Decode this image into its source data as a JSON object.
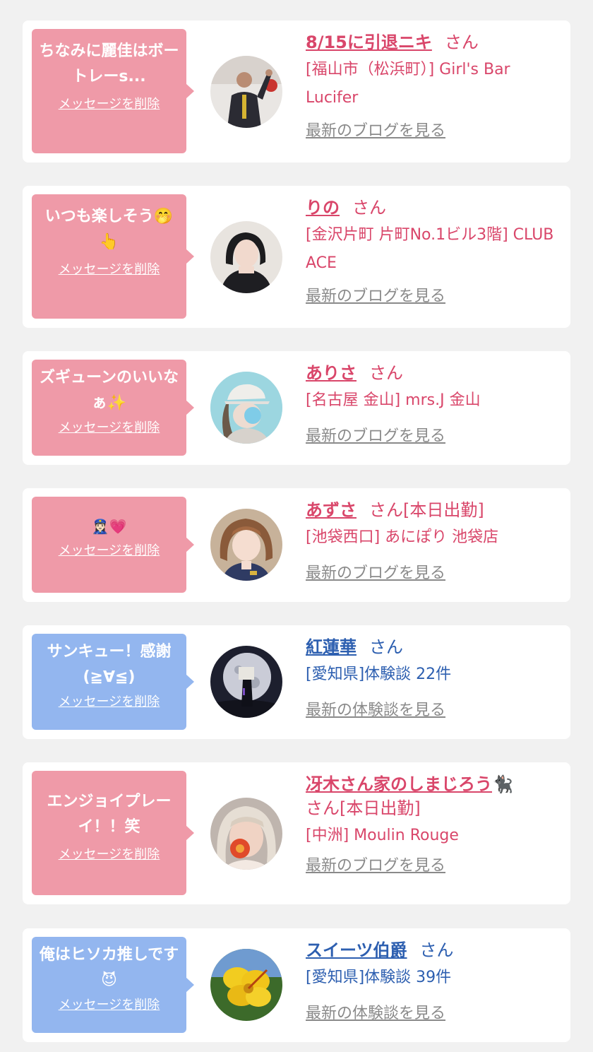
{
  "colors": {
    "pink_bubble": "#ef9aa8",
    "blue_bubble": "#93b6ef",
    "pink_text": "#d9466a",
    "blue_text": "#2d5fb0",
    "muted_link": "#8a8a8a",
    "background": "#f1f1f1"
  },
  "delete_label": "メッセージを削除",
  "cards": [
    {
      "theme": "pink",
      "message": "ちなみに麗佳はボートレーs...",
      "message_emoji": "",
      "name": "8/15に引退ニキ",
      "name_emoji": "",
      "suffix": "さん",
      "shop": "[福山市（松浜町）] Girl's Bar Lucifer",
      "link": "最新のブログを見る",
      "avatar_icon": "man-speaking-photo"
    },
    {
      "theme": "pink",
      "message": "いつも楽しそう",
      "message_emoji": "🤭👆",
      "name": "りの",
      "name_emoji": "",
      "suffix": "さん",
      "shop": "[金沢片町 片町No.1ビル3階] CLUB ACE",
      "link": "最新のブログを見る",
      "avatar_icon": "woman-portrait-photo"
    },
    {
      "theme": "pink",
      "message": "ズギューンのいいなぁ",
      "message_emoji": "✨",
      "name": "ありさ",
      "name_emoji": "",
      "suffix": "さん",
      "shop": "[名古屋 金山] mrs.J 金山",
      "link": "最新のブログを見る",
      "avatar_icon": "woman-cap-photo"
    },
    {
      "theme": "pink",
      "message": "",
      "message_emoji": "👮🏻‍♀️💗",
      "name": "あずさ",
      "name_emoji": "",
      "suffix": "さん[本日出勤]",
      "shop": "[池袋西口] あにぽり 池袋店",
      "link": "最新のブログを見る",
      "avatar_icon": "woman-police-photo"
    },
    {
      "theme": "blue",
      "message": "サンキュー！感謝(≧∀≦)",
      "message_emoji": "",
      "name": "紅蓮華",
      "name_emoji": "",
      "suffix": "さん",
      "shop": "[愛知県]体験談 22件",
      "link": "最新の体験談を見る",
      "avatar_icon": "moon-night-photo"
    },
    {
      "theme": "pink",
      "message": "エンジョイプレーイ！！笑",
      "message_emoji": "",
      "name": "冴木さん家のしまじろう",
      "name_emoji": "🐈‍⬛",
      "suffix": "さん[本日出勤]",
      "shop": "[中洲] Moulin Rouge",
      "link": "最新のブログを見る",
      "avatar_icon": "woman-flower-photo"
    },
    {
      "theme": "blue",
      "message": "俺はヒソカ推しです",
      "message_emoji": "😈",
      "name": "スイーツ伯爵",
      "name_emoji": "",
      "suffix": "さん",
      "shop": "[愛知県]体験談 39件",
      "link": "最新の体験談を見る",
      "avatar_icon": "yellow-hibiscus-photo"
    }
  ]
}
